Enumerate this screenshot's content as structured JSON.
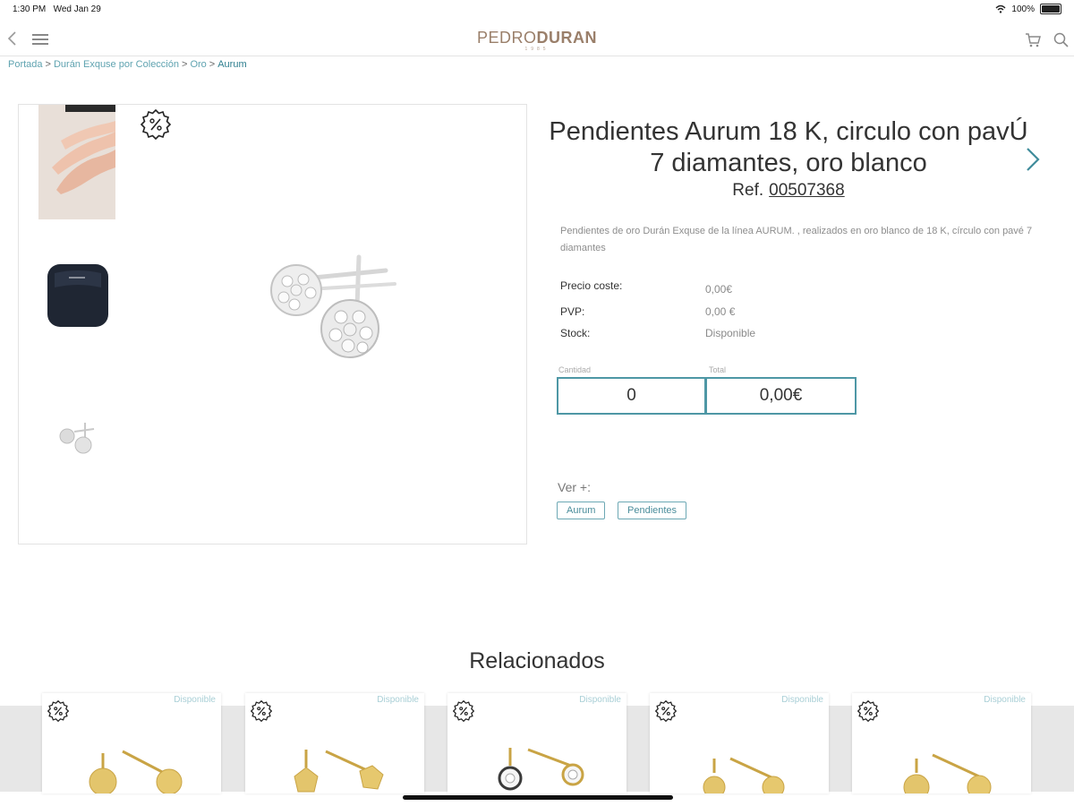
{
  "status_bar": {
    "time": "1:30 PM",
    "date": "Wed Jan 29",
    "battery": "100%"
  },
  "header": {
    "logo_left": "PEDRO",
    "logo_right": "DURAN",
    "logo_sub": "1985"
  },
  "breadcrumb": [
    {
      "label": "Portada"
    },
    {
      "label": "Durán Exquse por Colección"
    },
    {
      "label": "Oro"
    },
    {
      "label": "Aurum"
    }
  ],
  "breadcrumb_separator": ">",
  "product": {
    "title": "Pendientes Aurum 18 K, circulo con pavÚ 7 diamantes, oro blanco",
    "ref_label": "Ref.",
    "ref_number": "00507368",
    "description": "Pendientes de oro Durán Exquse de la línea AURUM. , realizados en oro blanco de 18 K, círculo con pavé 7 diamantes",
    "specs": [
      {
        "label": "Precio coste:",
        "value": "0,00€"
      },
      {
        "label": "PVP:",
        "value": "0,00 €"
      },
      {
        "label": "Stock:",
        "value": "Disponible"
      }
    ],
    "quantity_label": "Cantidad",
    "quantity_value": "0",
    "total_label": "Total",
    "total_value": "0,00€",
    "see_more_label": "Ver +:",
    "tags": [
      "Aurum",
      "Pendientes"
    ]
  },
  "related": {
    "title": "Relacionados",
    "items": [
      {
        "availability": "Disponible"
      },
      {
        "availability": "Disponible"
      },
      {
        "availability": "Disponible"
      },
      {
        "availability": "Disponible"
      },
      {
        "availability": "Disponible"
      }
    ]
  },
  "colors": {
    "accent": "#4e97a5",
    "link": "#5fa3b0",
    "logo": "#9a7f6a",
    "strip": "#e7e7e7"
  },
  "icons": [
    "back-icon",
    "menu-icon",
    "cart-icon",
    "search-icon",
    "discount-badge-icon",
    "chevron-right-icon"
  ]
}
